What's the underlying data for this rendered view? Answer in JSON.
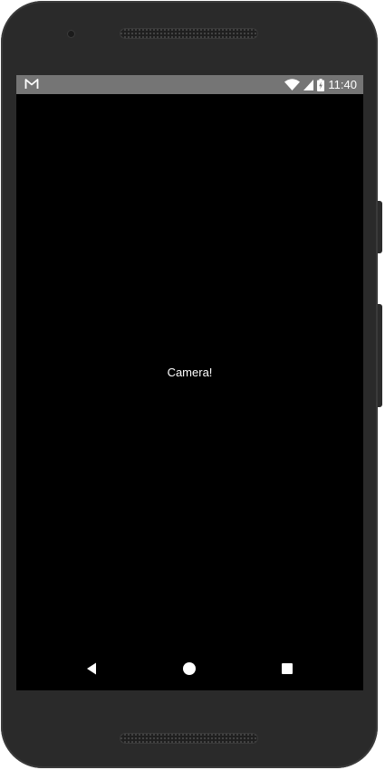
{
  "status_bar": {
    "notification_icon": "gmail-icon",
    "icons": [
      "wifi-icon",
      "cell-signal-icon",
      "battery-charging-icon"
    ],
    "time": "11:40"
  },
  "screen": {
    "text": "Camera!",
    "background": "#000000"
  },
  "nav_bar": {
    "buttons": [
      "back-icon",
      "home-icon",
      "recents-icon"
    ]
  },
  "colors": {
    "status_bar": "#757575",
    "device_body": "#2a2a2a"
  }
}
